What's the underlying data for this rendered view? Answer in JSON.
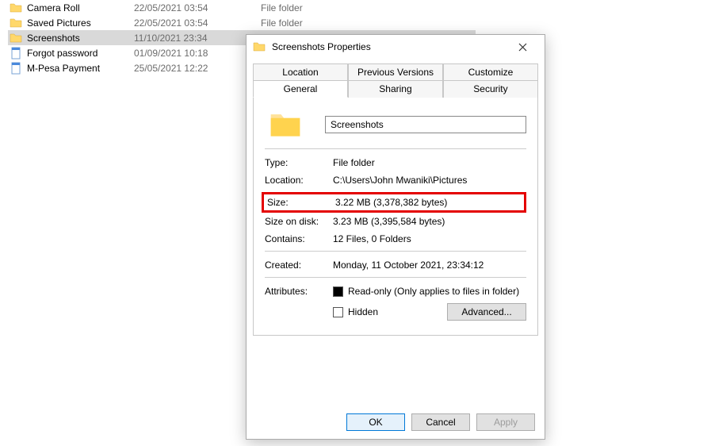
{
  "files": [
    {
      "icon": "folder",
      "name": "Camera Roll",
      "date": "22/05/2021 03:54",
      "type": "File folder",
      "selected": false
    },
    {
      "icon": "folder",
      "name": "Saved Pictures",
      "date": "22/05/2021 03:54",
      "type": "File folder",
      "selected": false
    },
    {
      "icon": "folder",
      "name": "Screenshots",
      "date": "11/10/2021 23:34",
      "type": "File folder",
      "selected": true
    },
    {
      "icon": "doc",
      "name": "Forgot password",
      "date": "01/09/2021 10:18",
      "type": "",
      "selected": false
    },
    {
      "icon": "doc",
      "name": "M-Pesa Payment",
      "date": "25/05/2021 12:22",
      "type": "",
      "selected": false
    }
  ],
  "dialog": {
    "title": "Screenshots Properties",
    "tabs_row1": [
      "Location",
      "Previous Versions",
      "Customize"
    ],
    "tabs_row2": [
      "General",
      "Sharing",
      "Security"
    ],
    "active_tab": "General",
    "folder_name": "Screenshots",
    "props": {
      "type_label": "Type:",
      "type_value": "File folder",
      "location_label": "Location:",
      "location_value": "C:\\Users\\John Mwaniki\\Pictures",
      "size_label": "Size:",
      "size_value": "3.22 MB (3,378,382 bytes)",
      "sod_label": "Size on disk:",
      "sod_value": "3.23 MB (3,395,584 bytes)",
      "contains_label": "Contains:",
      "contains_value": "12 Files, 0 Folders",
      "created_label": "Created:",
      "created_value": "Monday, 11 October 2021, 23:34:12",
      "attr_label": "Attributes:",
      "readonly_label": "Read-only (Only applies to files in folder)",
      "hidden_label": "Hidden",
      "advanced_label": "Advanced..."
    },
    "buttons": {
      "ok": "OK",
      "cancel": "Cancel",
      "apply": "Apply"
    }
  }
}
